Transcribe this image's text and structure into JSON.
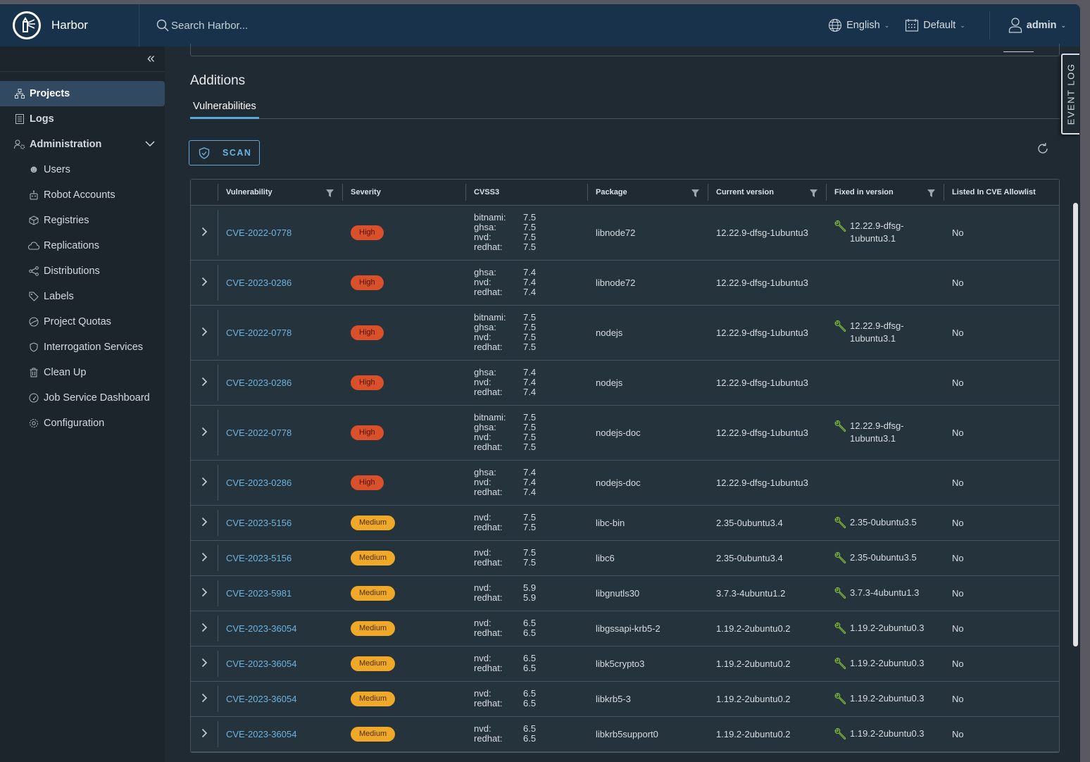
{
  "header": {
    "app_name": "Harbor",
    "search_placeholder": "Search Harbor...",
    "language": "English",
    "datetime_format": "Default",
    "user": "admin"
  },
  "sidebar": {
    "items": [
      {
        "label": "Projects",
        "icon": "projects-icon",
        "active": true
      },
      {
        "label": "Logs",
        "icon": "logs-icon"
      },
      {
        "label": "Administration",
        "icon": "administration-icon",
        "expanded": true
      }
    ],
    "admin_items": [
      {
        "label": "Users",
        "icon": "users-icon"
      },
      {
        "label": "Robot Accounts",
        "icon": "robot-icon"
      },
      {
        "label": "Registries",
        "icon": "registries-icon"
      },
      {
        "label": "Replications",
        "icon": "replications-icon"
      },
      {
        "label": "Distributions",
        "icon": "distributions-icon"
      },
      {
        "label": "Labels",
        "icon": "tag-icon"
      },
      {
        "label": "Project Quotas",
        "icon": "quota-icon"
      },
      {
        "label": "Interrogation Services",
        "icon": "shield-icon"
      },
      {
        "label": "Clean Up",
        "icon": "trash-icon"
      },
      {
        "label": "Job Service Dashboard",
        "icon": "dashboard-icon"
      },
      {
        "label": "Configuration",
        "icon": "gear-icon"
      }
    ]
  },
  "main": {
    "section_title": "Additions",
    "tabs": [
      {
        "label": "Vulnerabilities",
        "active": true
      }
    ],
    "scan_label": "SCAN",
    "event_log_label": "EVENT LOG",
    "columns": [
      "Vulnerability",
      "Severity",
      "CVSS3",
      "Package",
      "Current version",
      "Fixed in version",
      "Listed In CVE Allowlist"
    ],
    "rows": [
      {
        "cve": "CVE-2022-0778",
        "severity": "High",
        "cvss": [
          [
            "bitnami:",
            "7.5"
          ],
          [
            "ghsa:",
            "7.5"
          ],
          [
            "nvd:",
            "7.5"
          ],
          [
            "redhat:",
            "7.5"
          ]
        ],
        "package": "libnode72",
        "current": "12.22.9-dfsg-1ubuntu3",
        "fixed": "12.22.9-dfsg-1ubuntu3.1",
        "allowlist": "No"
      },
      {
        "cve": "CVE-2023-0286",
        "severity": "High",
        "cvss": [
          [
            "ghsa:",
            "7.4"
          ],
          [
            "nvd:",
            "7.4"
          ],
          [
            "redhat:",
            "7.4"
          ]
        ],
        "package": "libnode72",
        "current": "12.22.9-dfsg-1ubuntu3",
        "fixed": "",
        "allowlist": "No"
      },
      {
        "cve": "CVE-2022-0778",
        "severity": "High",
        "cvss": [
          [
            "bitnami:",
            "7.5"
          ],
          [
            "ghsa:",
            "7.5"
          ],
          [
            "nvd:",
            "7.5"
          ],
          [
            "redhat:",
            "7.5"
          ]
        ],
        "package": "nodejs",
        "current": "12.22.9-dfsg-1ubuntu3",
        "fixed": "12.22.9-dfsg-1ubuntu3.1",
        "allowlist": "No"
      },
      {
        "cve": "CVE-2023-0286",
        "severity": "High",
        "cvss": [
          [
            "ghsa:",
            "7.4"
          ],
          [
            "nvd:",
            "7.4"
          ],
          [
            "redhat:",
            "7.4"
          ]
        ],
        "package": "nodejs",
        "current": "12.22.9-dfsg-1ubuntu3",
        "fixed": "",
        "allowlist": "No"
      },
      {
        "cve": "CVE-2022-0778",
        "severity": "High",
        "cvss": [
          [
            "bitnami:",
            "7.5"
          ],
          [
            "ghsa:",
            "7.5"
          ],
          [
            "nvd:",
            "7.5"
          ],
          [
            "redhat:",
            "7.5"
          ]
        ],
        "package": "nodejs-doc",
        "current": "12.22.9-dfsg-1ubuntu3",
        "fixed": "12.22.9-dfsg-1ubuntu3.1",
        "allowlist": "No"
      },
      {
        "cve": "CVE-2023-0286",
        "severity": "High",
        "cvss": [
          [
            "ghsa:",
            "7.4"
          ],
          [
            "nvd:",
            "7.4"
          ],
          [
            "redhat:",
            "7.4"
          ]
        ],
        "package": "nodejs-doc",
        "current": "12.22.9-dfsg-1ubuntu3",
        "fixed": "",
        "allowlist": "No"
      },
      {
        "cve": "CVE-2023-5156",
        "severity": "Medium",
        "cvss": [
          [
            "nvd:",
            "7.5"
          ],
          [
            "redhat:",
            "7.5"
          ]
        ],
        "package": "libc-bin",
        "current": "2.35-0ubuntu3.4",
        "fixed": "2.35-0ubuntu3.5",
        "allowlist": "No"
      },
      {
        "cve": "CVE-2023-5156",
        "severity": "Medium",
        "cvss": [
          [
            "nvd:",
            "7.5"
          ],
          [
            "redhat:",
            "7.5"
          ]
        ],
        "package": "libc6",
        "current": "2.35-0ubuntu3.4",
        "fixed": "2.35-0ubuntu3.5",
        "allowlist": "No"
      },
      {
        "cve": "CVE-2023-5981",
        "severity": "Medium",
        "cvss": [
          [
            "nvd:",
            "5.9"
          ],
          [
            "redhat:",
            "5.9"
          ]
        ],
        "package": "libgnutls30",
        "current": "3.7.3-4ubuntu1.2",
        "fixed": "3.7.3-4ubuntu1.3",
        "allowlist": "No"
      },
      {
        "cve": "CVE-2023-36054",
        "severity": "Medium",
        "cvss": [
          [
            "nvd:",
            "6.5"
          ],
          [
            "redhat:",
            "6.5"
          ]
        ],
        "package": "libgssapi-krb5-2",
        "current": "1.19.2-2ubuntu0.2",
        "fixed": "1.19.2-2ubuntu0.3",
        "allowlist": "No"
      },
      {
        "cve": "CVE-2023-36054",
        "severity": "Medium",
        "cvss": [
          [
            "nvd:",
            "6.5"
          ],
          [
            "redhat:",
            "6.5"
          ]
        ],
        "package": "libk5crypto3",
        "current": "1.19.2-2ubuntu0.2",
        "fixed": "1.19.2-2ubuntu0.3",
        "allowlist": "No"
      },
      {
        "cve": "CVE-2023-36054",
        "severity": "Medium",
        "cvss": [
          [
            "nvd:",
            "6.5"
          ],
          [
            "redhat:",
            "6.5"
          ]
        ],
        "package": "libkrb5-3",
        "current": "1.19.2-2ubuntu0.2",
        "fixed": "1.19.2-2ubuntu0.3",
        "allowlist": "No"
      },
      {
        "cve": "CVE-2023-36054",
        "severity": "Medium",
        "cvss": [
          [
            "nvd:",
            "6.5"
          ],
          [
            "redhat:",
            "6.5"
          ]
        ],
        "package": "libkrb5support0",
        "current": "1.19.2-2ubuntu0.2",
        "fixed": "1.19.2-2ubuntu0.3",
        "allowlist": "No"
      }
    ]
  },
  "colors": {
    "header_bg": "#17324a",
    "accent": "#5fa8d8",
    "high": "#d9502a",
    "medium": "#f0a829",
    "fix_icon": "#7fb83a"
  }
}
